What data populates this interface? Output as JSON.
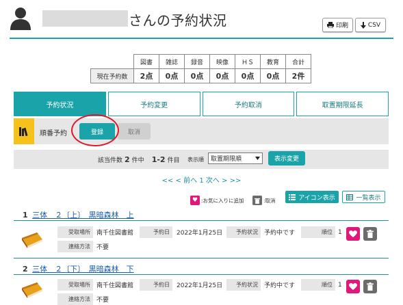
{
  "header": {
    "title_suffix": "さんの予約状況",
    "print_label": "印刷",
    "csv_label": "CSV"
  },
  "counts": {
    "headers": [
      "図書",
      "雑誌",
      "録音",
      "映像",
      "ＨＳ",
      "教育",
      "合計"
    ],
    "row_label": "現在予約数",
    "values": [
      "2点",
      "0点",
      "0点",
      "0点",
      "0点",
      "0点",
      "2件"
    ]
  },
  "tabs": [
    "予約状況",
    "予約変更",
    "予約取消",
    "取置期限延長"
  ],
  "reservation_bar": {
    "label": "順番予約",
    "register": "登録",
    "cancel": "取消"
  },
  "sort": {
    "hits_prefix": "該当件数",
    "hits_count": "2",
    "hits_suffix": "件中",
    "range": "1-2",
    "range_suffix": "件目",
    "order_label": "表示順",
    "order_value": "取置期限順",
    "change_button": "表示変更"
  },
  "pager": "<< < 前へ 1 次へ > >>",
  "legend": {
    "fav": ":お気に入りに追加",
    "delete": ":取消"
  },
  "view": {
    "icon_view": "アイコン表示",
    "list_view": "一覧表示"
  },
  "labels": {
    "pickup": "受取場所",
    "reserved_date": "予約日",
    "status": "予約状況",
    "rank": "順位",
    "contact": "連絡方法"
  },
  "items": [
    {
      "number": "1",
      "title": "三体　２〔上〕　黒暗森林　上",
      "pickup": "南千住図書館",
      "reserved_date": "2022年1月25日",
      "status": "予約中です",
      "rank": "1",
      "contact": "不要"
    },
    {
      "number": "2",
      "title": "三体　２〔下〕　黒暗森林　下",
      "pickup": "南千住図書館",
      "reserved_date": "2022年1月25日",
      "status": "予約中です",
      "rank": "1",
      "contact": "不要"
    }
  ],
  "colors": {
    "accent": "#1aa3a8",
    "highlight_circle": "#e0162b",
    "favorite": "#e0187a",
    "book_icon_bg": "#f4c21b"
  }
}
